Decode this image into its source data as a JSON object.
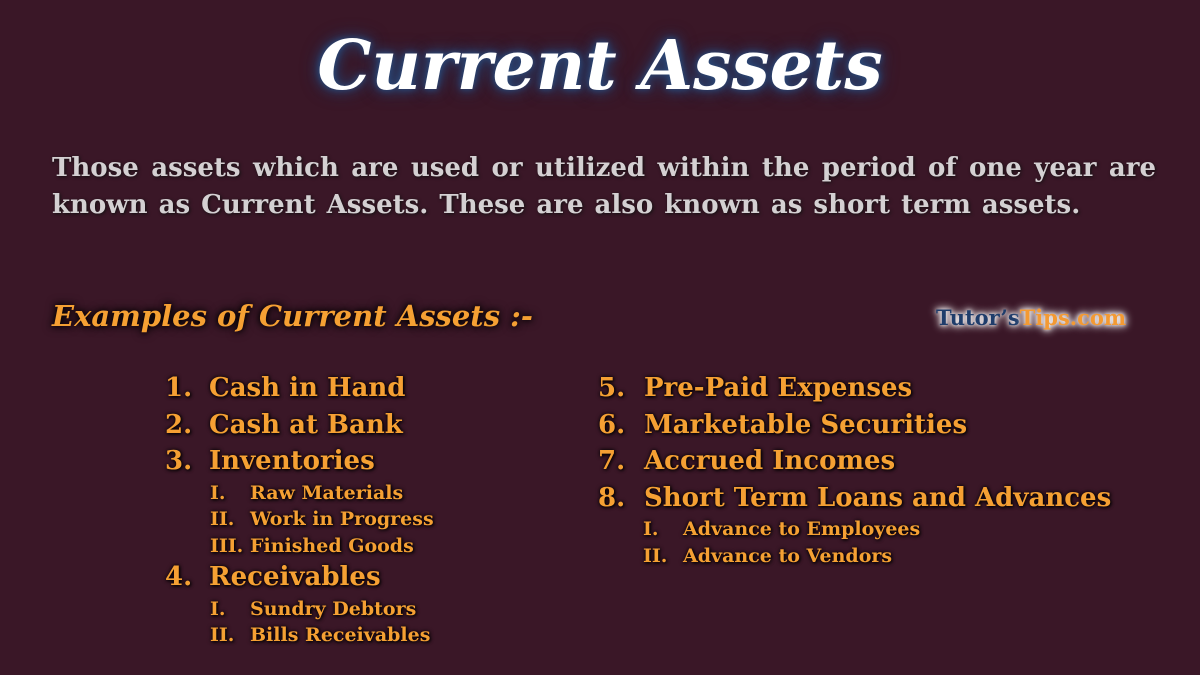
{
  "title": "Current Assets",
  "description": "Those assets which are used or utilized within the period of one year are known as Current Assets. These are also known as short term assets.",
  "subheading": "Examples  of  Current Assets :-",
  "brand": {
    "part1": "Tutor’s",
    "part2": "Tips.com",
    "color1": "#1f3d6b",
    "color2": "#f39a33"
  },
  "colors": {
    "background": "#3a1727",
    "accent": "#f5a033",
    "title": "#ffffff",
    "body": "#d4d0d2"
  },
  "column1": [
    {
      "num": "1.",
      "label": "Cash in Hand",
      "subs": []
    },
    {
      "num": "2.",
      "label": "Cash at Bank",
      "subs": []
    },
    {
      "num": "3.",
      "label": "Inventories",
      "subs": [
        {
          "num": "I.",
          "label": "Raw Materials"
        },
        {
          "num": "II.",
          "label": "Work in Progress"
        },
        {
          "num": "III.",
          "label": "Finished Goods"
        }
      ]
    },
    {
      "num": "4.",
      "label": "Receivables",
      "subs": [
        {
          "num": "I.",
          "label": "Sundry Debtors"
        },
        {
          "num": "II.",
          "label": "Bills Receivables"
        }
      ]
    }
  ],
  "column2": [
    {
      "num": "5.",
      "label": "Pre-Paid Expenses",
      "subs": []
    },
    {
      "num": "6.",
      "label": "Marketable Securities",
      "subs": []
    },
    {
      "num": "7.",
      "label": "Accrued Incomes",
      "subs": []
    },
    {
      "num": "8.",
      "label": "Short Term Loans and Advances",
      "subs": [
        {
          "num": "I.",
          "label": "Advance to Employees"
        },
        {
          "num": "II.",
          "label": "Advance to Vendors"
        }
      ]
    }
  ]
}
